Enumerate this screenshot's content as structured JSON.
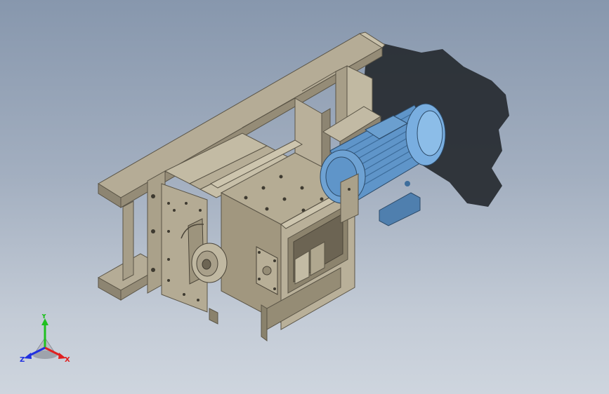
{
  "viewport": {
    "background_top": "#8797ad",
    "background_bottom": "#ced5de"
  },
  "model": {
    "frame_color": "#b1a893",
    "frame_dark": "#7e7664",
    "housing_color": "#aea38a",
    "motor_color": "#5f95c9",
    "motor_light": "#86b5e0",
    "shadow_color": "#262a30"
  },
  "triad": {
    "x_label": "X",
    "y_label": "Y",
    "z_label": "Z",
    "x_color": "#e02020",
    "y_color": "#20c020",
    "z_color": "#2030e0"
  }
}
